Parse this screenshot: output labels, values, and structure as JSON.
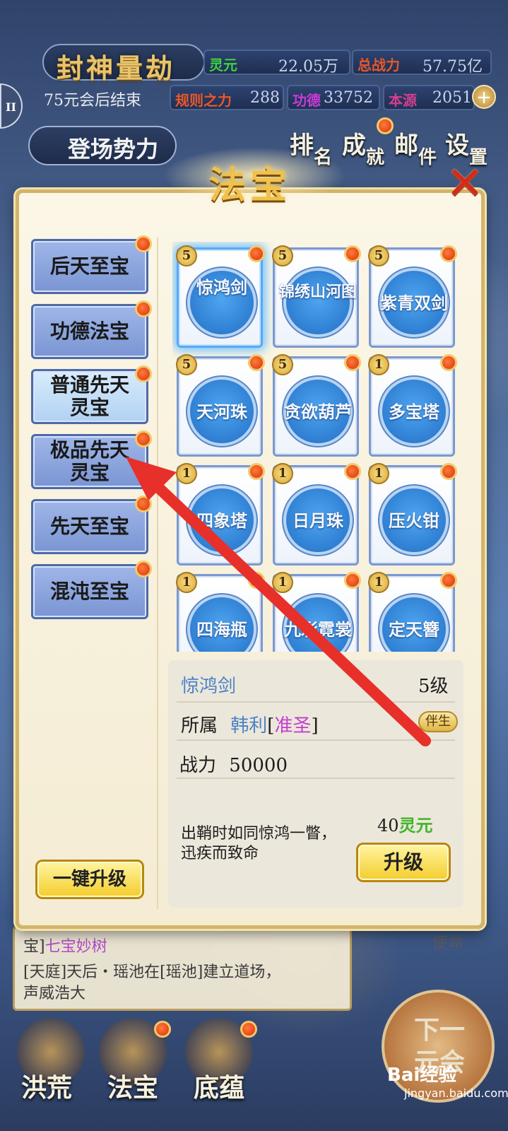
{
  "header": {
    "world_title": "封神量劫",
    "countdown": "75元会后结束",
    "stats": [
      {
        "label": "灵元",
        "value": "22.05万",
        "color": "#3fd13f"
      },
      {
        "label": "总战力",
        "value": "57.75亿",
        "color": "#e8572a"
      },
      {
        "label": "规则之力",
        "value": "288",
        "color": "#e8572a"
      },
      {
        "label": "功德",
        "value": "33752",
        "color": "#c73bd6"
      },
      {
        "label": "本源",
        "value": "2051",
        "color": "#d33f8f"
      }
    ],
    "side_tab": "II",
    "faction_button": "登场势力",
    "nav": [
      {
        "big": "排",
        "small": "名"
      },
      {
        "big": "成",
        "small": "就"
      },
      {
        "big": "邮",
        "small": "件"
      },
      {
        "big": "设",
        "small": "置"
      }
    ]
  },
  "dialog": {
    "title": "法宝",
    "close_icon": "close-x-icon",
    "categories": [
      {
        "label": "后天至宝"
      },
      {
        "label": "功德法宝"
      },
      {
        "label": "普通先天灵宝"
      },
      {
        "label": "极品先天灵宝"
      },
      {
        "label": "先天至宝"
      },
      {
        "label": "混沌至宝"
      }
    ],
    "active_category": "普通先天灵宝",
    "treasures": [
      {
        "name": "惊鸿剑",
        "level": "5"
      },
      {
        "name": "锦绣山河图",
        "level": "5"
      },
      {
        "name": "紫青双剑",
        "level": "5"
      },
      {
        "name": "天河珠",
        "level": "5"
      },
      {
        "name": "贪欲葫芦",
        "level": "5"
      },
      {
        "name": "多宝塔",
        "level": "1"
      },
      {
        "name": "四象塔",
        "level": "1"
      },
      {
        "name": "日月珠",
        "level": "1"
      },
      {
        "name": "压火钳",
        "level": "1"
      },
      {
        "name": "四海瓶",
        "level": "1"
      },
      {
        "name": "九彩霓裳",
        "level": "1"
      },
      {
        "name": "定天簪",
        "level": "1"
      }
    ],
    "selected": {
      "name": "惊鸿剑",
      "level": "5级",
      "owner_label": "所属",
      "owner_name": "韩利",
      "owner_bracket_open": "[",
      "owner_rank": "准圣",
      "owner_bracket_close": "]",
      "tag": "伴生",
      "power_label": "战力",
      "power_value": "50000",
      "description": "出鞘时如同惊鸿一瞥，迅疾而致命",
      "cost_value": "40",
      "cost_unit": "灵元",
      "upgrade_label": "升级"
    },
    "onekey_label": "一键升级"
  },
  "background": {
    "info_line1_prefix": "宝]",
    "info_line1_item": "七宝妙树",
    "info_line2": "[天庭]天后・瑶池在[瑶池]建立道场，",
    "info_line3": "声威浩大",
    "mission_tag": "使命",
    "bottom_nav": [
      "洪荒",
      "法宝",
      "底蕴"
    ],
    "next_button": "下一元会"
  },
  "watermark": {
    "brand": "Bai经验",
    "url": "jingyan.baidu.com"
  },
  "colors": {
    "annotation_arrow": "#e8302a",
    "accent_gold": "#d3b46b"
  }
}
